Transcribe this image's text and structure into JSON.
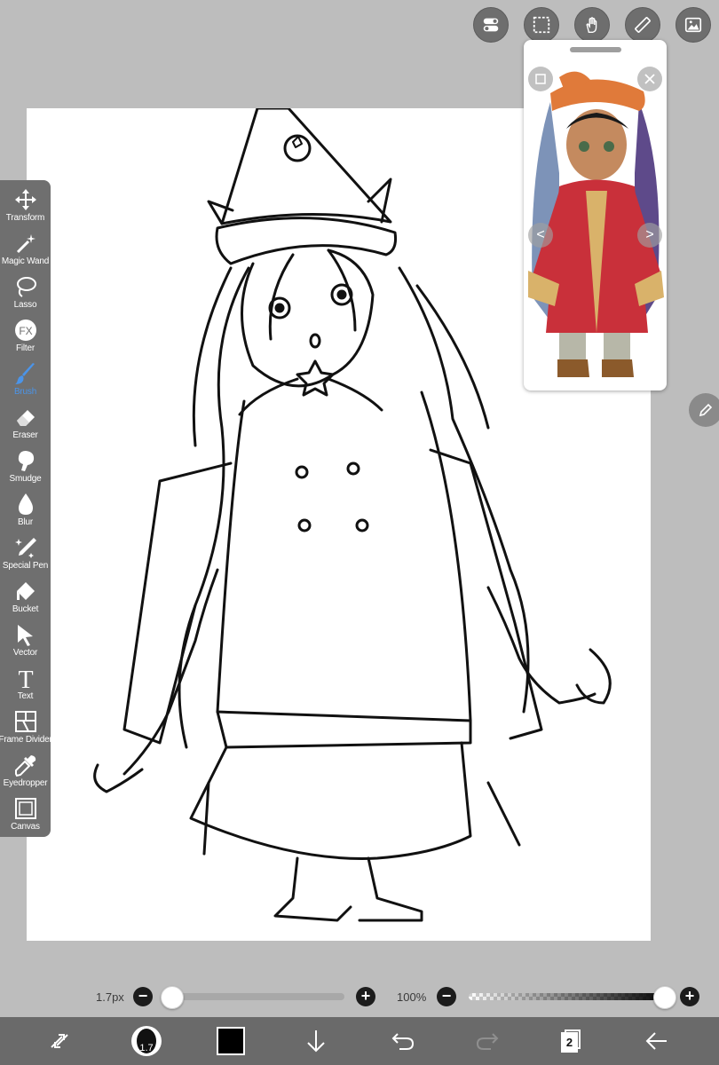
{
  "top_toolbar": {
    "icons": [
      "layers-toggle-icon",
      "selection-icon",
      "hand-icon",
      "ruler-icon",
      "image-icon"
    ]
  },
  "reference_window": {
    "nav_prev": "<",
    "nav_next": ">"
  },
  "tools": [
    {
      "label": "Transform",
      "icon": "transform-icon"
    },
    {
      "label": "Magic Wand",
      "icon": "magic-wand-icon"
    },
    {
      "label": "Lasso",
      "icon": "lasso-icon"
    },
    {
      "label": "Filter",
      "icon": "filter-icon"
    },
    {
      "label": "Brush",
      "icon": "brush-icon",
      "active": true
    },
    {
      "label": "Eraser",
      "icon": "eraser-icon"
    },
    {
      "label": "Smudge",
      "icon": "smudge-icon"
    },
    {
      "label": "Blur",
      "icon": "blur-icon"
    },
    {
      "label": "Special Pen",
      "icon": "special-pen-icon"
    },
    {
      "label": "Bucket",
      "icon": "bucket-icon"
    },
    {
      "label": "Vector",
      "icon": "vector-icon"
    },
    {
      "label": "Text",
      "icon": "text-icon"
    },
    {
      "label": "Frame Divider",
      "icon": "frame-divider-icon"
    },
    {
      "label": "Eyedropper",
      "icon": "eyedropper-icon"
    },
    {
      "label": "Canvas",
      "icon": "canvas-icon"
    }
  ],
  "filter_icon_text": "FX",
  "text_icon_text": "T",
  "brush_size": {
    "label": "1.7px",
    "minus": "−",
    "plus": "+",
    "value_fraction": 0.0
  },
  "opacity": {
    "label": "100%",
    "minus": "−",
    "plus": "+",
    "value_fraction": 1.0
  },
  "bottom_bar": {
    "brush_preview_size": "1.7",
    "color": "#000000",
    "layer_count": "2"
  },
  "colors": {
    "palette_bg": "#6f6f6f",
    "active_tool": "#4b94e8",
    "background": "#bdbdbd"
  }
}
